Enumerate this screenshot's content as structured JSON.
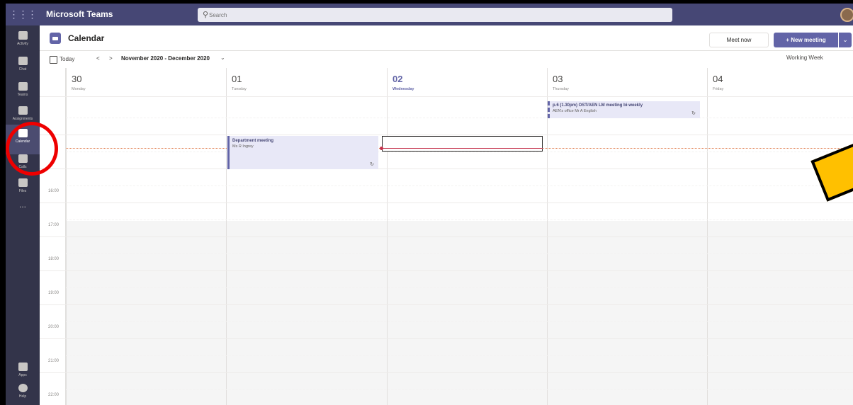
{
  "app": {
    "title": "Microsoft Teams"
  },
  "search": {
    "placeholder": "Search"
  },
  "rail": {
    "items": [
      {
        "label": "Activity",
        "icon": "bell-icon"
      },
      {
        "label": "Chat",
        "icon": "chat-icon"
      },
      {
        "label": "Teams",
        "icon": "teams-icon"
      },
      {
        "label": "Assignments",
        "icon": "assignments-icon"
      },
      {
        "label": "Calendar",
        "icon": "calendar-icon",
        "active": true
      },
      {
        "label": "Calls",
        "icon": "phone-icon"
      },
      {
        "label": "Files",
        "icon": "files-icon"
      }
    ],
    "more": "...",
    "apps": "Apps",
    "help": "Help"
  },
  "header": {
    "title": "Calendar",
    "meet_now": "Meet now",
    "new_meeting": "+ New meeting"
  },
  "nav": {
    "today": "Today",
    "prev": "<",
    "next": ">",
    "range": "November 2020 - December 2020",
    "view": "Working Week"
  },
  "days": [
    {
      "num": "30",
      "name": "Monday"
    },
    {
      "num": "01",
      "name": "Tuesday"
    },
    {
      "num": "02",
      "name": "Wednesday",
      "today": true
    },
    {
      "num": "03",
      "name": "Thursday"
    },
    {
      "num": "04",
      "name": "Friday"
    }
  ],
  "times": [
    "16:00",
    "17:00",
    "18:00",
    "19:00",
    "20:00",
    "21:00",
    "22:00"
  ],
  "events": [
    {
      "title": "Department meeting",
      "subtitle": "Ms R Ingrey",
      "day": "Tuesday"
    },
    {
      "title": "p.6 (1.30pm) OST/AEN LM meeting bi-weekly",
      "subtitle": "AEN's office  Mr A English",
      "day": "Thursday"
    }
  ]
}
